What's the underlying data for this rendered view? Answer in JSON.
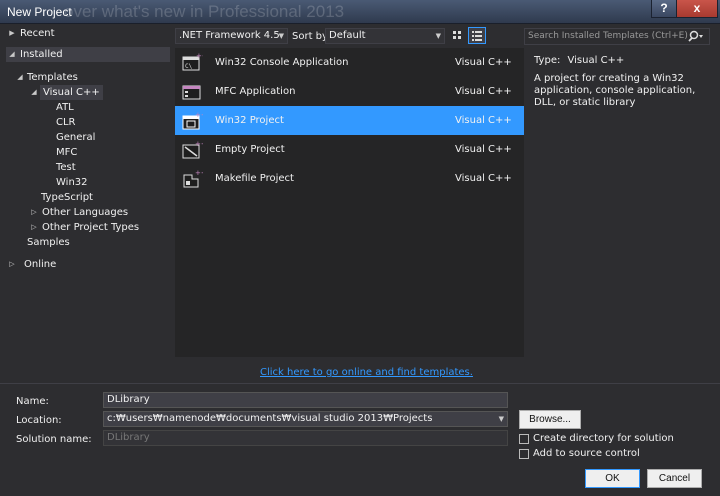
{
  "window": {
    "title": "New Project",
    "background_text": "over what's new in Professional 2013",
    "help_label": "?",
    "close_label": "x"
  },
  "nav": {
    "recent": "Recent",
    "installed": "Installed",
    "templates": "Templates",
    "visual_cpp": "Visual C++",
    "sub_items": [
      "ATL",
      "CLR",
      "General",
      "MFC",
      "Test",
      "Win32"
    ],
    "typescript": "TypeScript",
    "other_languages": "Other Languages",
    "other_project_types": "Other Project Types",
    "samples": "Samples",
    "online": "Online"
  },
  "toolbar": {
    "framework": ".NET Framework 4.5",
    "sort_by_label": "Sort by:",
    "sort_value": "Default",
    "search_placeholder": "Search Installed Templates (Ctrl+E)"
  },
  "templates": [
    {
      "name": "Win32 Console Application",
      "lang": "Visual C++"
    },
    {
      "name": "MFC Application",
      "lang": "Visual C++"
    },
    {
      "name": "Win32 Project",
      "lang": "Visual C++",
      "selected": true
    },
    {
      "name": "Empty Project",
      "lang": "Visual C++"
    },
    {
      "name": "Makefile Project",
      "lang": "Visual C++"
    }
  ],
  "details": {
    "type_label": "Type:",
    "type_value": "Visual C++",
    "description": "A project for creating a Win32 application, console application, DLL, or static library"
  },
  "online_link": "Click here to go online and find templates.",
  "form": {
    "name_label": "Name:",
    "name_value": "DLibrary",
    "location_label": "Location:",
    "location_value": "c:₩users₩namenode₩documents₩visual studio 2013₩Projects",
    "solution_label": "Solution name:",
    "solution_value": "DLibrary",
    "browse": "Browse...",
    "create_dir": "Create directory for solution",
    "add_source": "Add to source control",
    "ok": "OK",
    "cancel": "Cancel"
  },
  "colors": {
    "selection": "#3399ff",
    "background": "#2d2d30",
    "list_background": "#252526"
  }
}
